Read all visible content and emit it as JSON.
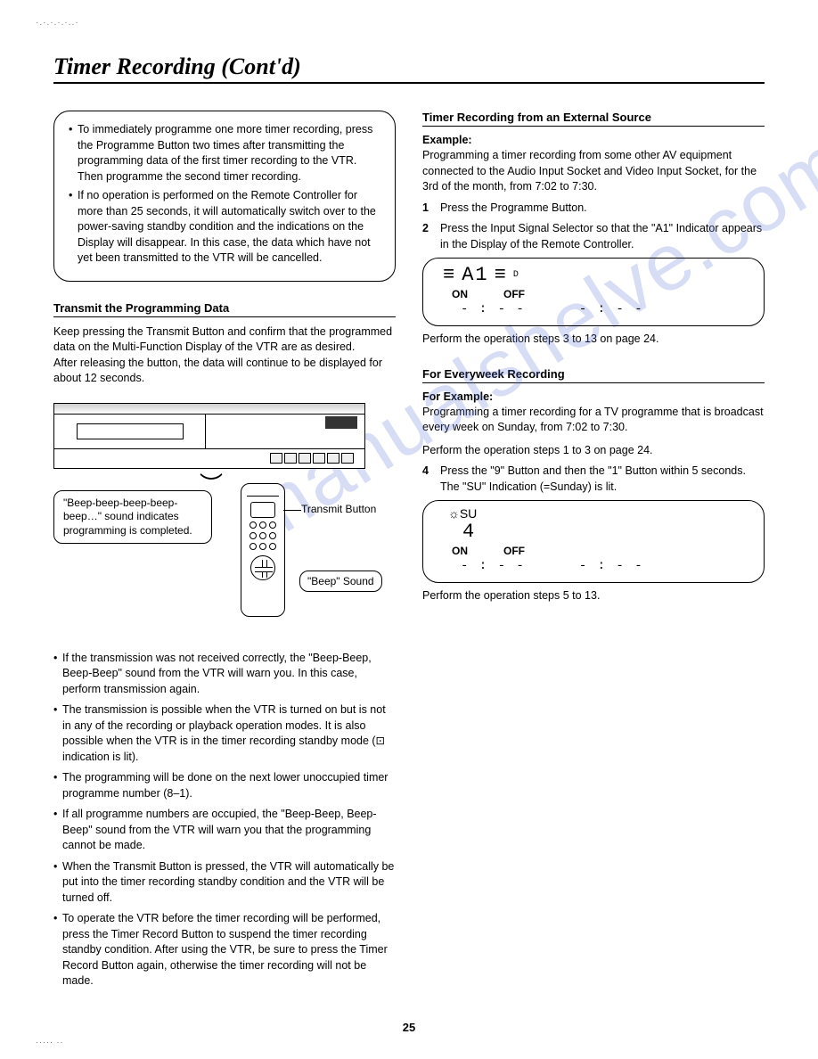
{
  "title": "Timer Recording (Cont'd)",
  "watermark": "manualshelve.com",
  "left": {
    "box_items": [
      "To immediately programme one more timer recording, press the Programme Button two times after transmitting the programming data of the first timer recording to the VTR. Then programme the second timer recording.",
      "If no operation is performed on the Remote Controller for more than 25 seconds, it will automatically switch over to the power-saving standby condition and the indications on the Display will disappear. In this case, the data which have not yet been transmitted to the VTR will be cancelled."
    ],
    "transmit_heading": "Transmit the Programming Data",
    "transmit_body_1": "Keep pressing the Transmit Button and confirm that the programmed data on the Multi-Function Display of the VTR are as desired.",
    "transmit_body_2": "After releasing the button, the data will continue to be displayed for about 12 seconds.",
    "callout_beep": "\"Beep-beep-beep-beep-beep…\" sound indicates programming is completed.",
    "label_transmit": "Transmit Button",
    "label_beep_sound": "\"Beep\" Sound",
    "notes": [
      "If the transmission was not received correctly, the \"Beep-Beep, Beep-Beep\" sound from the VTR will warn you. In this case, perform transmission again.",
      "The transmission is possible when the VTR is turned on but is not in any of the recording or playback operation modes. It is also possible when the VTR is in the timer recording standby mode (⊡ indication is lit).",
      "The programming will be done on the next lower unoccupied timer programme number (8–1).",
      "If all programme numbers are occupied, the \"Beep-Beep, Beep-Beep\" sound from the VTR will warn you that the programming cannot be made.",
      "When the Transmit Button is pressed, the VTR will automatically be put into the timer recording standby condition and the VTR will be turned off.",
      "To operate the VTR before the timer recording will be performed, press the Timer Record Button to suspend the timer recording standby condition. After using the VTR, be sure to press the Timer Record Button again, otherwise the timer recording will not be made."
    ]
  },
  "right": {
    "ext_heading": "Timer Recording from an External Source",
    "example_label": "Example:",
    "example_text": "Programming a timer recording from some other AV equipment connected to the Audio Input Socket and Video Input Socket, for the 3rd of the month, from 7:02 to 7:30.",
    "step1": "Press the Programme Button.",
    "step2": "Press the Input Signal Selector so that the \"A1\" Indicator appears in the Display of the Remote Controller.",
    "lcd1_big": "A1",
    "lcd1_d": "D",
    "on": "ON",
    "off": "OFF",
    "time_dashes": "- : - -",
    "perform_3_13": "Perform the operation steps 3 to 13 on page 24.",
    "every_heading": "For Everyweek Recording",
    "for_example": "For Example:",
    "every_text": "Programming a timer recording for a TV programme that is broadcast every week on Sunday, from 7:02 to 7:30.",
    "perform_1_3": "Perform the operation steps 1 to 3 on page 24.",
    "step4": "Press the \"9\" Button and then the \"1\" Button within 5 seconds. The \"SU\" Indication (=Sunday) is lit.",
    "lcd2_su": "SU",
    "lcd2_4": "4",
    "perform_5_13": "Perform the operation steps 5 to 13."
  },
  "page_number": "25"
}
